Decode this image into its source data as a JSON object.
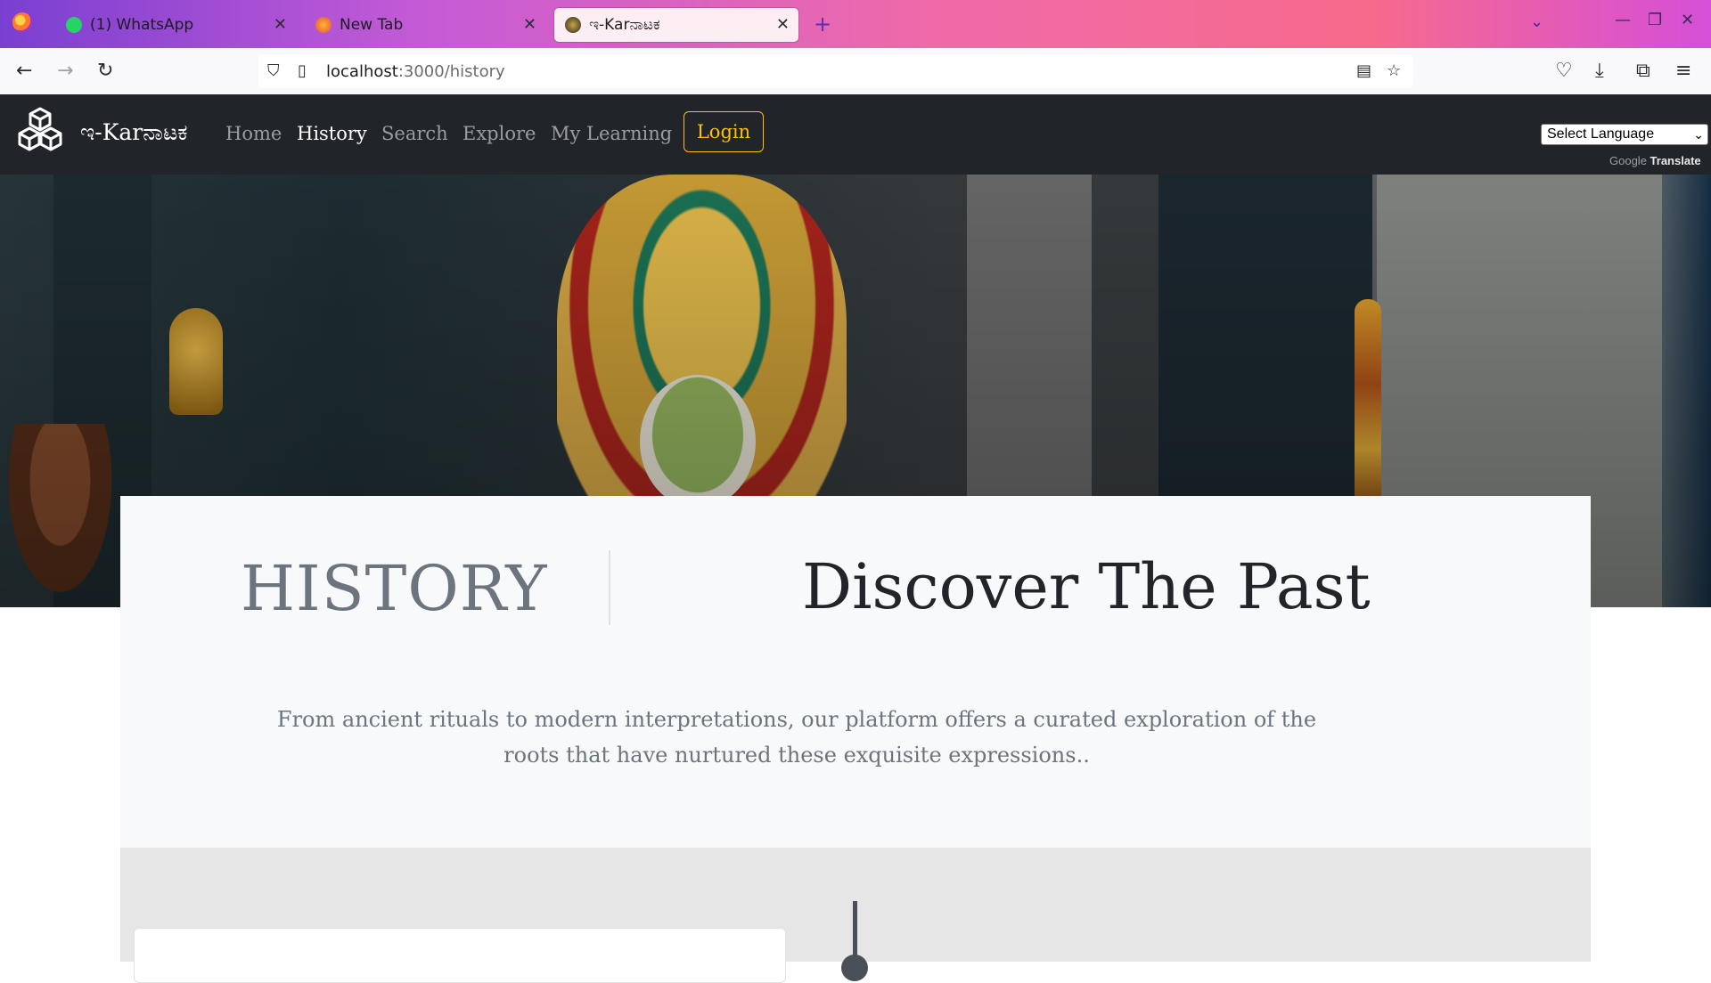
{
  "browser": {
    "tabs": [
      {
        "title": "(1) WhatsApp",
        "favicon": "whatsapp-icon"
      },
      {
        "title": "New Tab",
        "favicon": "firefox-icon"
      },
      {
        "title": "ಇ-Karನಾಟಕ",
        "favicon": "site-icon"
      }
    ],
    "url_host": "localhost",
    "url_path": ":3000/history"
  },
  "site": {
    "brand": "ಇ-Karನಾಟಕ",
    "nav": [
      {
        "label": "Home"
      },
      {
        "label": "History"
      },
      {
        "label": "Search"
      },
      {
        "label": "Explore"
      },
      {
        "label": "My Learning"
      }
    ],
    "login_label": "Login",
    "language_select": "Select Language",
    "powered_google": "Google",
    "powered_translate": "Translate"
  },
  "section": {
    "label": "HISTORY",
    "heading": "Discover The Past",
    "text": "From ancient rituals to modern interpretations, our platform offers a curated exploration of the roots that have nurtured these exquisite expressions.."
  },
  "colors": {
    "header_bg": "#212529",
    "accent": "#ffc107",
    "card_bg": "#f8f9fa"
  }
}
